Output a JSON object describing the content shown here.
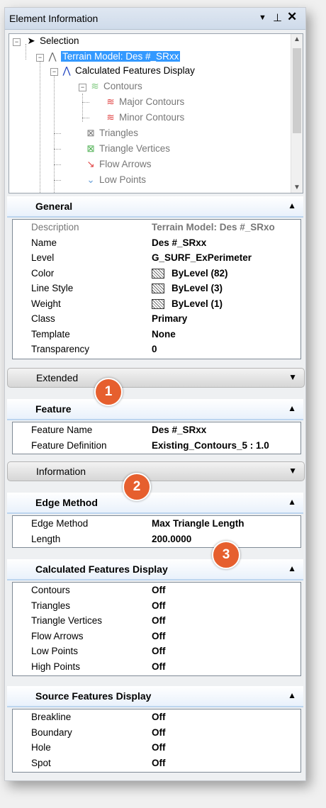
{
  "window": {
    "title": "Element Information"
  },
  "tree": [
    "Selection",
    "Terrain Model: Des #_SRxx",
    "Calculated Features Display",
    "Contours",
    "Major Contours",
    "Minor Contours",
    "Triangles",
    "Triangle Vertices",
    "Flow Arrows",
    "Low Points"
  ],
  "general": {
    "title": "General",
    "rows": [
      {
        "k": "Description",
        "v": "Terrain Model: Des #_SRxo"
      },
      {
        "k": "Name",
        "v": "Des #_SRxx"
      },
      {
        "k": "Level",
        "v": "G_SURF_ExPerimeter"
      },
      {
        "k": "Color",
        "v": "ByLevel (82)"
      },
      {
        "k": "Line Style",
        "v": "ByLevel (3)"
      },
      {
        "k": "Weight",
        "v": "ByLevel (1)"
      },
      {
        "k": "Class",
        "v": "Primary"
      },
      {
        "k": "Template",
        "v": "None"
      },
      {
        "k": "Transparency",
        "v": "0"
      }
    ]
  },
  "extended": {
    "title": "Extended"
  },
  "feature": {
    "title": "Feature",
    "rows": [
      {
        "k": "Feature Name",
        "v": "Des #_SRxx"
      },
      {
        "k": "Feature Definition",
        "v": "Existing_Contours_5 : 1.0"
      }
    ]
  },
  "information": {
    "title": "Information"
  },
  "edge_method": {
    "title": "Edge Method",
    "rows": [
      {
        "k": "Edge Method",
        "v": "Max Triangle Length"
      },
      {
        "k": "Length",
        "v": "200.0000"
      }
    ]
  },
  "calc_display": {
    "title": "Calculated Features Display",
    "rows": [
      {
        "k": "Contours",
        "v": "Off"
      },
      {
        "k": "Triangles",
        "v": "Off"
      },
      {
        "k": "Triangle Vertices",
        "v": "Off"
      },
      {
        "k": "Flow Arrows",
        "v": "Off"
      },
      {
        "k": "Low Points",
        "v": "Off"
      },
      {
        "k": "High Points",
        "v": "Off"
      }
    ]
  },
  "source_display": {
    "title": "Source Features Display",
    "rows": [
      {
        "k": "Breakline",
        "v": "Off"
      },
      {
        "k": "Boundary",
        "v": "Off"
      },
      {
        "k": "Hole",
        "v": "Off"
      },
      {
        "k": "Spot",
        "v": "Off"
      }
    ]
  },
  "badges": [
    "1",
    "2",
    "3"
  ],
  "colors": {
    "badge": "#e65f2e",
    "selection": "#3399ff"
  }
}
